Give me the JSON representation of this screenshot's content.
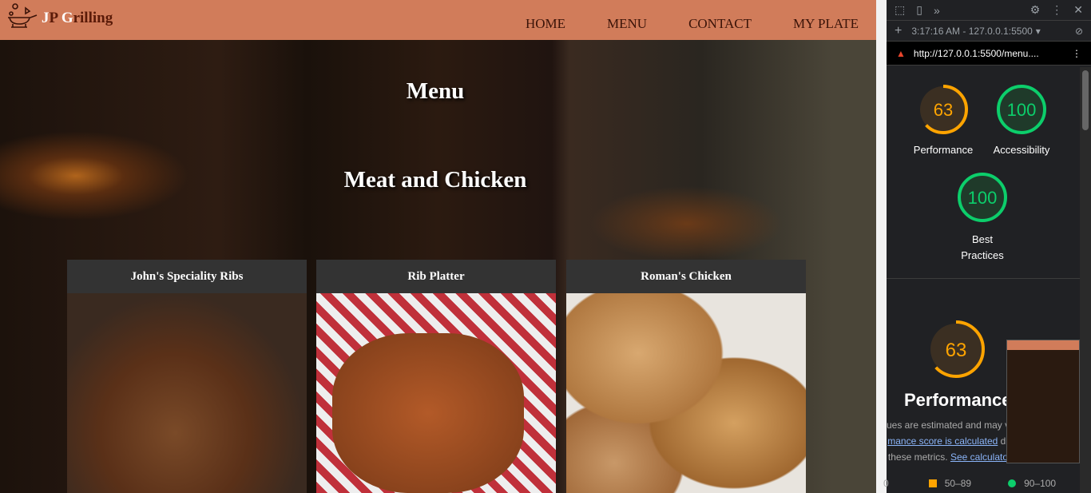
{
  "site": {
    "brand_first": "J",
    "brand_p": "P ",
    "brand_g": "G",
    "brand_rest": "rilling",
    "nav": [
      "HOME",
      "MENU",
      "CONTACT",
      "MY PLATE"
    ],
    "title": "Menu",
    "section": "Meat and Chicken",
    "cards": [
      {
        "title": "John's Speciality Ribs"
      },
      {
        "title": "Rib Platter"
      },
      {
        "title": "Roman's Chicken"
      }
    ]
  },
  "devtools": {
    "report_select": "3:17:16 AM - 127.0.0.1:5500",
    "url": "http://127.0.0.1:5500/menu....",
    "scores": [
      {
        "label": "Performance",
        "value": 63,
        "color": "#ffa400"
      },
      {
        "label": "Accessibility",
        "value": 100,
        "color": "#0cce6b"
      },
      {
        "label": "Best Practices",
        "value": 100,
        "color": "#0cce6b"
      }
    ],
    "perf_title": "Performance",
    "perf_score": 63,
    "desc_line1": "ues are estimated and may va",
    "desc_link1": "mance score is calculated",
    "desc_line2b": " di",
    "desc_line3": "these metrics. ",
    "desc_link2": "See calculato",
    "legend": [
      "0",
      "50–89",
      "90–100"
    ]
  }
}
